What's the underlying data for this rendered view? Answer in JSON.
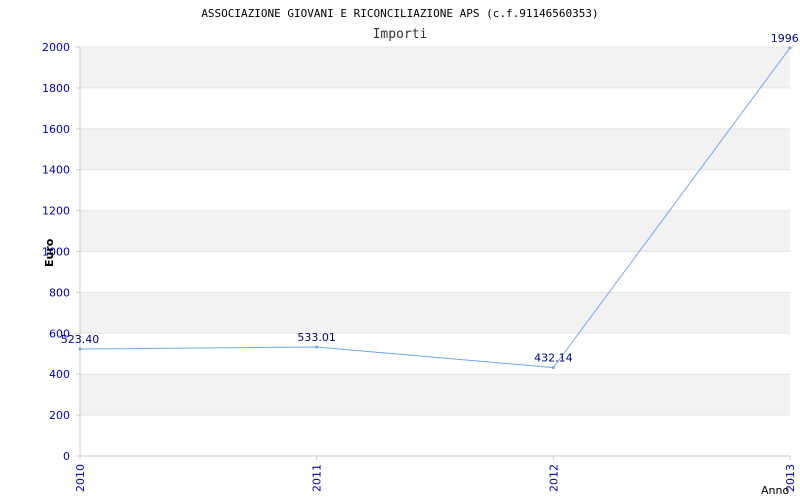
{
  "chart_data": {
    "type": "line",
    "title": "ASSOCIAZIONE GIOVANI E RICONCILIAZIONE APS (c.f.91146560353)",
    "subtitle": "Importi",
    "xlabel": "Anno",
    "ylabel": "Euro",
    "categories": [
      "2010",
      "2011",
      "2012",
      "2013"
    ],
    "series": [
      {
        "values": [
          523.4,
          533.01,
          432.14,
          1996.0
        ]
      }
    ],
    "data_labels": [
      "523.40",
      "533.01",
      "432.14",
      "1996.0"
    ],
    "ylim": [
      0,
      2000
    ],
    "yticks": [
      "0",
      "200",
      "400",
      "600",
      "800",
      "1000",
      "1200",
      "1400",
      "1600",
      "1800",
      "2000"
    ],
    "grid": true,
    "colors": {
      "line": "#6fa8f0",
      "band": "#f2f2f2",
      "grid": "#e6e6e6",
      "axis_text": "#0000bb",
      "label_text": "#000080"
    }
  }
}
